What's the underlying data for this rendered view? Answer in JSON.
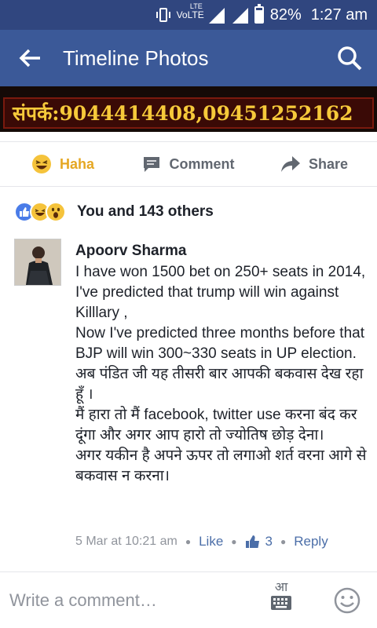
{
  "status_bar": {
    "network": "VoLTE",
    "network_badge": "LTE",
    "battery": "82%",
    "battery_level": 0.82,
    "time": "1:27 am"
  },
  "header": {
    "title": "Timeline Photos",
    "back_icon": "arrow-left-icon",
    "search_icon": "search-icon"
  },
  "photo": {
    "banner_text": "संपर्क:9044414408,09451252162"
  },
  "actions": {
    "haha_label": "Haha",
    "comment_label": "Comment",
    "share_label": "Share"
  },
  "reactions": {
    "icons": [
      "like-icon",
      "haha-icon",
      "wow-icon"
    ],
    "summary": "You and 143 others"
  },
  "comment": {
    "author": "Apoorv Sharma",
    "lines": [
      "I have won 1500 bet on 250+ seats in 2014, I've predicted that trump will win against Killlary ,",
      "Now I've predicted three months before that BJP will win 300~330 seats in UP election.",
      "अब पंडित जी यह तीसरी बार आपकी बकवास देख रहा हूँ ।",
      "मैं हारा तो मैं facebook, twitter use करना बंद कर दूंगा और अगर आप हारो तो ज्योतिष छोड़ देना।",
      "अगर यकीन है अपने ऊपर तो लगाओ शर्त वरना आगे से बकवास न करना।"
    ],
    "timestamp": "5 Mar at 10:21 am",
    "like_label": "Like",
    "like_count": "3",
    "reply_label": "Reply"
  },
  "composer": {
    "placeholder": "Write a comment…",
    "keyboard_glyph": "आ"
  },
  "colors": {
    "status_bar": "#30467f",
    "header": "#3b5998",
    "haha": "#e5a723",
    "link": "#4b6ea8",
    "muted": "#90949c"
  }
}
